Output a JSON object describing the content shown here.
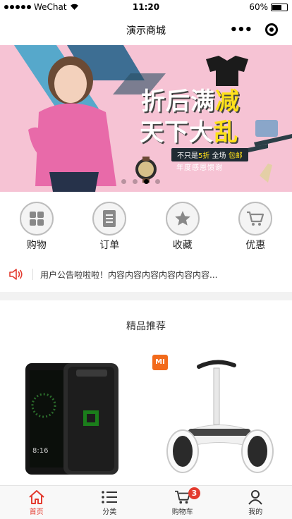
{
  "status_bar": {
    "carrier": "WeChat",
    "time": "11:20",
    "battery": "60%"
  },
  "nav": {
    "title": "演示商城"
  },
  "banner": {
    "line1_white": "折后满",
    "line1_yellow": "减",
    "line2_white": "天下大",
    "line2_yellow": "乱",
    "pill_prefix": "不只是",
    "pill_discount": "5折",
    "pill_middle": " 全场 ",
    "pill_suffix": "包邮",
    "subtitle": "年度感恩馈谢",
    "slide_count": 4,
    "active_slide": 3
  },
  "categories": [
    {
      "label": "购物",
      "icon": "grid-icon"
    },
    {
      "label": "订单",
      "icon": "document-icon"
    },
    {
      "label": "收藏",
      "icon": "star-icon"
    },
    {
      "label": "优惠",
      "icon": "cart-icon"
    }
  ],
  "notice": {
    "text": "用户公告啦啦啦！内容内容内容内容内容内容..."
  },
  "recommend": {
    "title": "精品推荐",
    "products": [
      {
        "brand_logo": ""
      },
      {
        "brand_logo": "MI"
      }
    ]
  },
  "tabbar": [
    {
      "label": "首页",
      "icon": "home-icon",
      "active": true
    },
    {
      "label": "分类",
      "icon": "list-icon",
      "active": false
    },
    {
      "label": "购物车",
      "icon": "cart-icon",
      "active": false,
      "badge": "3"
    },
    {
      "label": "我的",
      "icon": "user-icon",
      "active": false
    }
  ],
  "colors": {
    "accent": "#e33b2f",
    "banner_bg": "#f6c3d4",
    "highlight": "#ffe11a"
  }
}
